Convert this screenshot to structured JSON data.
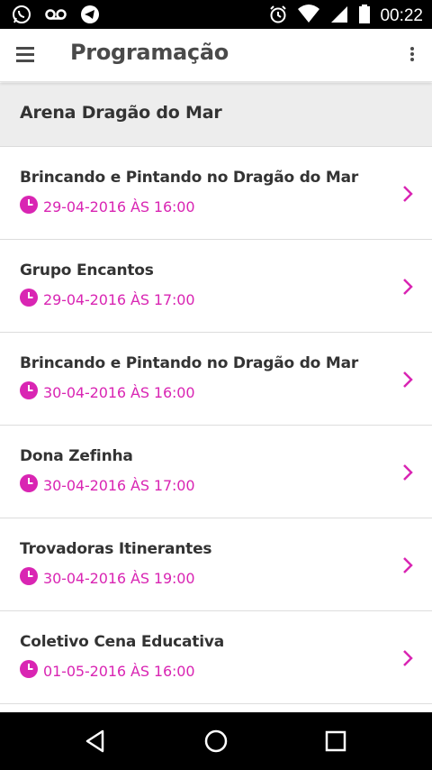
{
  "status_bar": {
    "time": "00:22",
    "icons": [
      "whatsapp-icon",
      "voicemail-icon",
      "telegram-icon",
      "alarm-icon",
      "wifi-icon",
      "signal-icon",
      "battery-icon"
    ]
  },
  "app_bar": {
    "title": "Programação",
    "menu_icon": "hamburger-menu-icon",
    "more_icon": "more-vert-icon"
  },
  "section": {
    "title": "Arena Dragão do Mar"
  },
  "events": [
    {
      "name": "Brincando e Pintando no Dragão do Mar",
      "date": "29-04-2016 ÀS 16:00"
    },
    {
      "name": "Grupo Encantos",
      "date": "29-04-2016 ÀS 17:00"
    },
    {
      "name": "Brincando e Pintando no Dragão do Mar",
      "date": "30-04-2016 ÀS 16:00"
    },
    {
      "name": "Dona Zefinha",
      "date": "30-04-2016 ÀS 17:00"
    },
    {
      "name": "Trovadoras Itinerantes",
      "date": "30-04-2016 ÀS 19:00"
    },
    {
      "name": "Coletivo Cena Educativa",
      "date": "01-05-2016 ÀS 16:00"
    }
  ],
  "nav_bar": {
    "icons": [
      "back-icon",
      "home-icon",
      "recents-icon"
    ]
  },
  "colors": {
    "accent": "#d925b3",
    "section_bg": "#ededed",
    "text": "#333333"
  }
}
